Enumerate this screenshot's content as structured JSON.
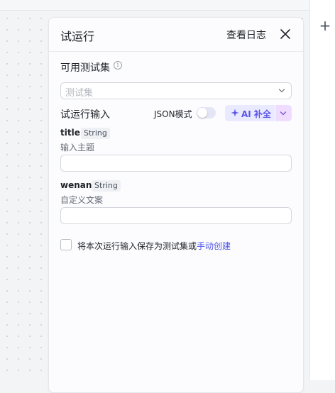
{
  "right_rail": {
    "add_icon": "plus-icon",
    "add_glyph": "+"
  },
  "panel": {
    "title": "试运行",
    "view_log_label": "查看日志",
    "close_icon": "close-icon",
    "test_set_label": "可用测试集",
    "info_glyph": "i",
    "test_set_placeholder": "测试集",
    "run_input_label": "试运行输入",
    "json_mode_label": "JSON模式",
    "json_mode_enabled": false,
    "ai_fill_label": "AI 补全",
    "fields": [
      {
        "name": "title",
        "type": "String",
        "description": "输入主题",
        "value": ""
      },
      {
        "name": "wenan",
        "type": "String",
        "description": "自定义文案",
        "value": ""
      }
    ],
    "save_checkbox_checked": false,
    "save_text": "将本次运行输入保存为测试集或",
    "manual_create_link": "手动创建"
  },
  "colors": {
    "accent": "#4d53e8",
    "ai_label": "#5b55e6",
    "ai_button_bg": "#e9eaff",
    "ai_dropdown_bg": "#f0dcff"
  }
}
